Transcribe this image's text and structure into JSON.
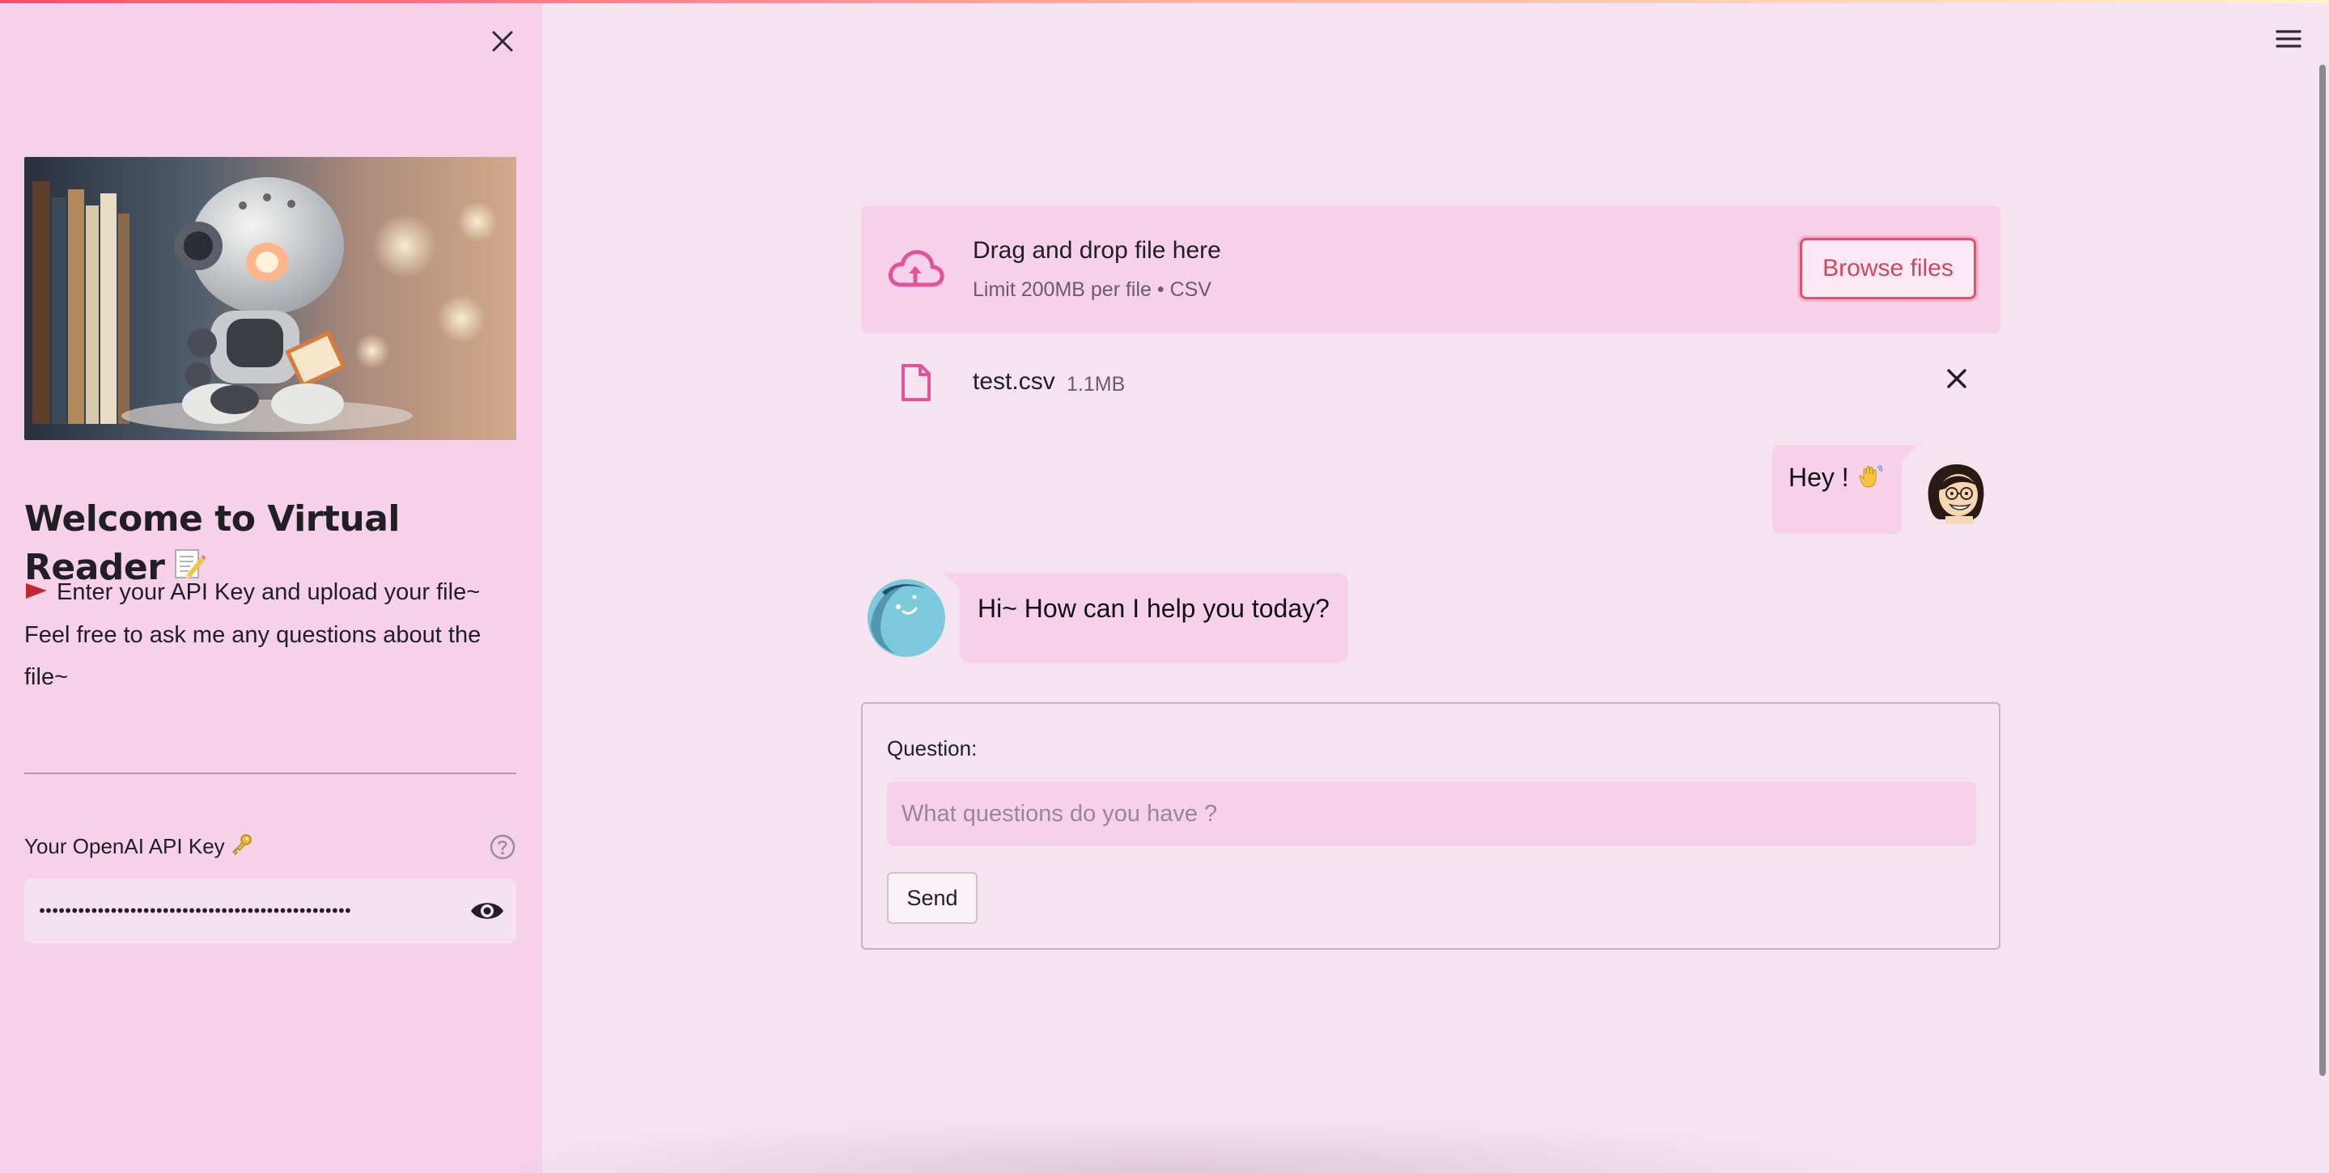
{
  "sidebar": {
    "title": "Welcome to Virtual Reader",
    "intro_line1": "Enter your API Key and upload your file~",
    "intro_line2": "Feel free to ask me any questions about the file~",
    "api_key": {
      "label": "Your OpenAI API Key",
      "value": "sk-virtualreaderdemokeyxxxxxxxxxxxxxxxxxxxxxxxxx"
    }
  },
  "uploader": {
    "drop_title": "Drag and drop file here",
    "drop_subtitle": "Limit 200MB per file • CSV",
    "browse_label": "Browse files"
  },
  "uploaded_file": {
    "name": "test.csv",
    "size": "1.1MB"
  },
  "chat": {
    "messages": [
      {
        "role": "user",
        "text": "Hey !",
        "emoji": "waving-hand"
      },
      {
        "role": "assistant",
        "text": "Hi~ How can I help you today?"
      }
    ]
  },
  "form": {
    "question_label": "Question:",
    "question_placeholder": "What questions do you have ?",
    "question_value": "",
    "send_label": "Send"
  },
  "colors": {
    "sidebar_bg": "#f7d1ea",
    "main_bg": "#f5e4f0",
    "accent": "#e0506e",
    "icon_pink": "#e0559a"
  }
}
